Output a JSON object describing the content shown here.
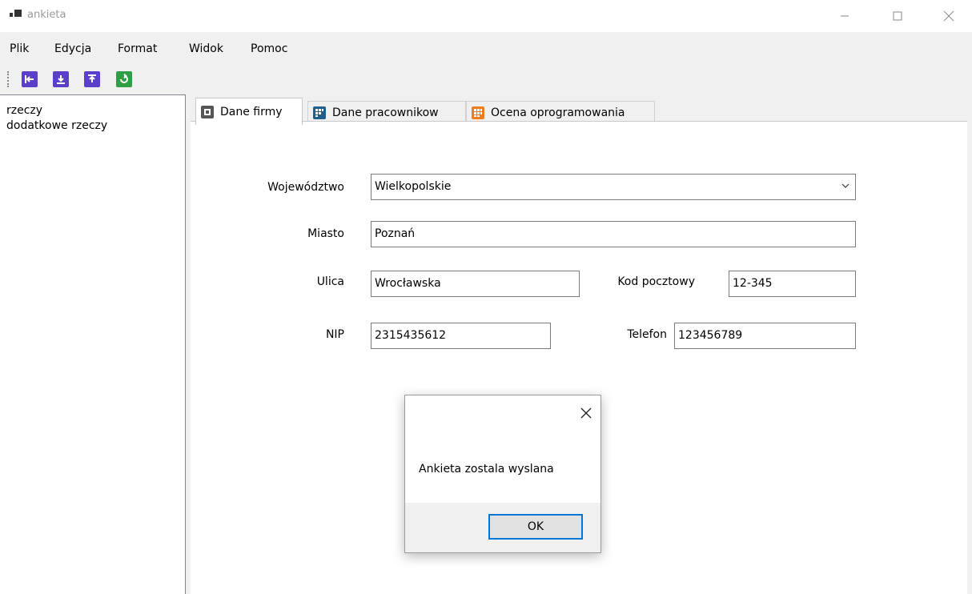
{
  "window": {
    "title": "ankieta"
  },
  "menu": {
    "items": [
      "Plik",
      "Edycja",
      "Format",
      "Widok",
      "Pomoc"
    ]
  },
  "toolbar": {
    "buttons": [
      {
        "icon": "exit-icon",
        "color": "#5b3fc8"
      },
      {
        "icon": "download-icon",
        "color": "#5b3fc8"
      },
      {
        "icon": "upload-icon",
        "color": "#5b3fc8"
      },
      {
        "icon": "refresh-icon",
        "color": "#2f9e44"
      }
    ]
  },
  "tree": {
    "items": [
      "rzeczy",
      "dodatkowe rzeczy"
    ]
  },
  "tabs": [
    {
      "label": "Dane firmy",
      "icon": "form-icon",
      "color": "#555555",
      "active": true
    },
    {
      "label": "Dane pracownikow",
      "icon": "grid-icon",
      "color": "#1f5f8b",
      "active": false
    },
    {
      "label": "Ocena oprogramowania",
      "icon": "rating-grid-icon",
      "color": "#f07d1a",
      "active": false
    }
  ],
  "form": {
    "wojewodztwo_label": "Województwo",
    "wojewodztwo_value": "Wielkopolskie",
    "miasto_label": "Miasto",
    "miasto_value": "Poznań",
    "ulica_label": "Ulica",
    "ulica_value": "Wrocławska",
    "kod_label": "Kod pocztowy",
    "kod_value": "12-345",
    "nip_label": "NIP",
    "nip_value": "2315435612",
    "telefon_label": "Telefon",
    "telefon_value": "123456789"
  },
  "dialog": {
    "message": "Ankieta zostala wyslana",
    "ok_label": "OK"
  }
}
